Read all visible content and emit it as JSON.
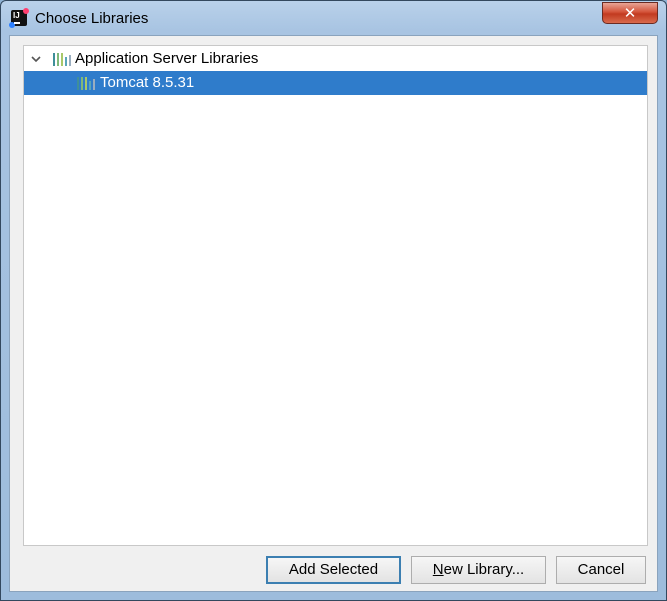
{
  "window": {
    "title": "Choose Libraries",
    "close_glyph": "✕",
    "app_icon_text": "IJ"
  },
  "tree": {
    "root": {
      "label": "Application Server Libraries",
      "expanded": true,
      "icon": "library-icon",
      "expander_icon": "chevron-down-icon"
    },
    "children": [
      {
        "label": "Tomcat 8.5.31",
        "selected": true,
        "icon": "library-icon"
      }
    ]
  },
  "buttons": {
    "add_selected": "Add Selected",
    "new_library_mnemonic": "N",
    "new_library_rest": "ew Library...",
    "cancel": "Cancel"
  },
  "colors": {
    "selection": "#2f7ccb",
    "icon_bars": [
      "#3f8f99",
      "#7fb97a",
      "#a8c86a",
      "#5aa6b8",
      "#9aaec0"
    ]
  }
}
